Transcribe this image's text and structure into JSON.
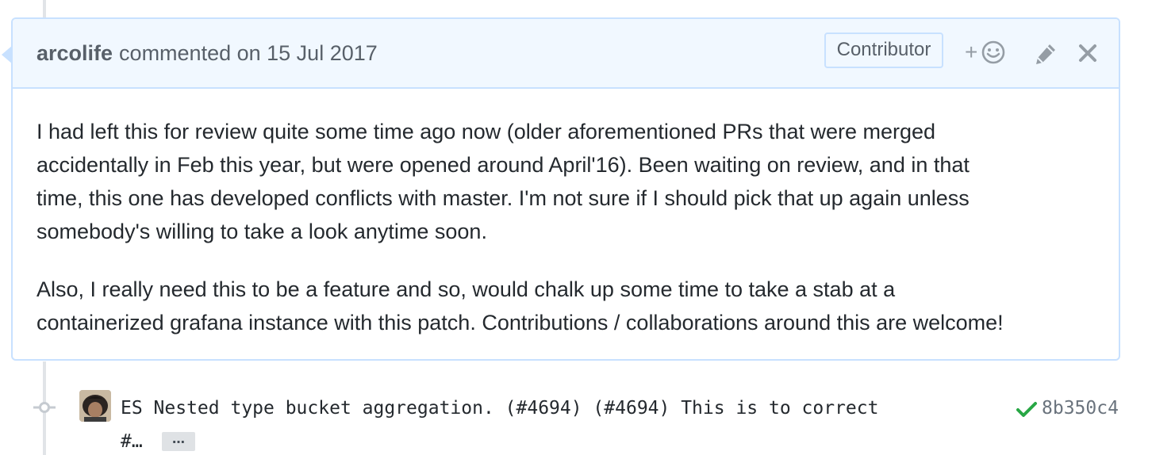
{
  "comment": {
    "author": "arcolife",
    "action_text": "commented on 15 Jul 2017",
    "role_badge": "Contributor",
    "reaction_label": "+",
    "body": {
      "paragraph1": {
        "line1": "I had left this for review quite some time ago now (older aforementioned PRs that were merged",
        "line2": "accidentally in Feb this year, but were opened around April'16). Been waiting on review, and in that",
        "line3": "time, this one has developed conflicts with master. I'm not sure if I should pick that up again unless",
        "line4": "somebody's willing to take a look anytime soon."
      },
      "paragraph2": {
        "line1": "Also, I really need this to be a feature and so, would chalk up some time to take a stab at a",
        "line2": "containerized grafana instance with this patch. Contributions / collaborations around this are welcome!"
      }
    },
    "icons": {
      "reaction": "smiley-icon",
      "edit": "pencil-icon",
      "close": "close-icon"
    }
  },
  "commit": {
    "message": "ES Nested type bucket aggregation. (#4694) (#4694) This is to correct",
    "message_cont": "#…",
    "expand_label": "…",
    "sha": "8b350c4",
    "status_icon": "check-icon",
    "node_icon": "git-commit-icon",
    "avatar": "avatar"
  },
  "colors": {
    "header_bg": "#f1f8ff",
    "border": "#c8e1ff",
    "text": "#24292e",
    "muted": "#586069",
    "success": "#28a745"
  }
}
